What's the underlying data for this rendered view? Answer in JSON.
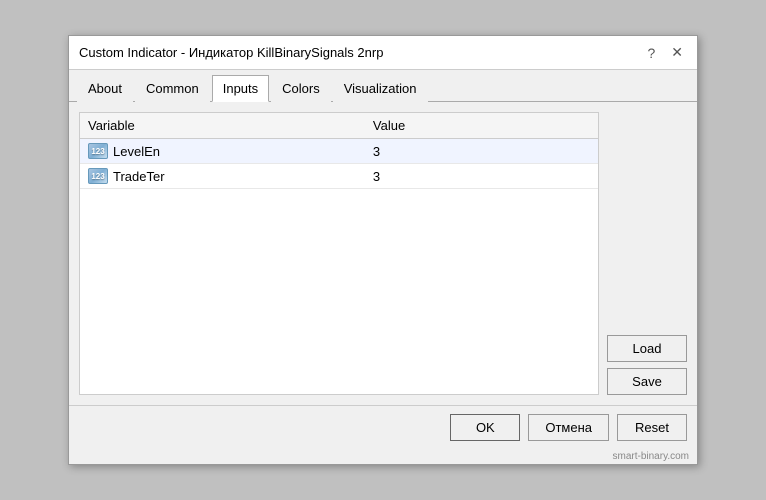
{
  "window": {
    "title": "Custom Indicator - Индикатор KillBinarySignals 2nrp",
    "help_btn": "?",
    "close_btn": "✕"
  },
  "tabs": [
    {
      "id": "about",
      "label": "About",
      "active": false
    },
    {
      "id": "common",
      "label": "Common",
      "active": false
    },
    {
      "id": "inputs",
      "label": "Inputs",
      "active": true
    },
    {
      "id": "colors",
      "label": "Colors",
      "active": false
    },
    {
      "id": "visualization",
      "label": "Visualization",
      "active": false
    }
  ],
  "table": {
    "col_variable": "Variable",
    "col_value": "Value",
    "rows": [
      {
        "icon": "123",
        "variable": "LevelEn",
        "value": "3"
      },
      {
        "icon": "123",
        "variable": "TradeTer",
        "value": "3"
      }
    ]
  },
  "side_buttons": {
    "load": "Load",
    "save": "Save"
  },
  "bottom_buttons": {
    "ok": "OK",
    "cancel": "Отмена",
    "reset": "Reset"
  },
  "watermark": "smart-binary.com"
}
